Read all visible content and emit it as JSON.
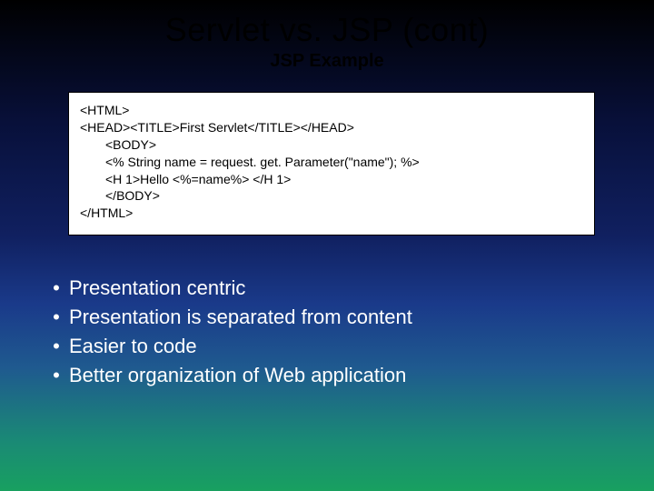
{
  "title": "Servlet vs. JSP (cont)",
  "subtitle": "JSP Example",
  "code": {
    "l1": "<HTML>",
    "l2": "<HEAD><TITLE>First Servlet</TITLE></HEAD>",
    "l3": "<BODY>",
    "l4": "<% String name = request. get. Parameter(\"name\"); %>",
    "l5": "<H 1>Hello <%=name%> </H 1>",
    "l6": "</BODY>",
    "l7": "</HTML>"
  },
  "bullets": [
    "Presentation centric",
    "Presentation is separated from content",
    "Easier to code",
    "Better organization of Web application"
  ]
}
